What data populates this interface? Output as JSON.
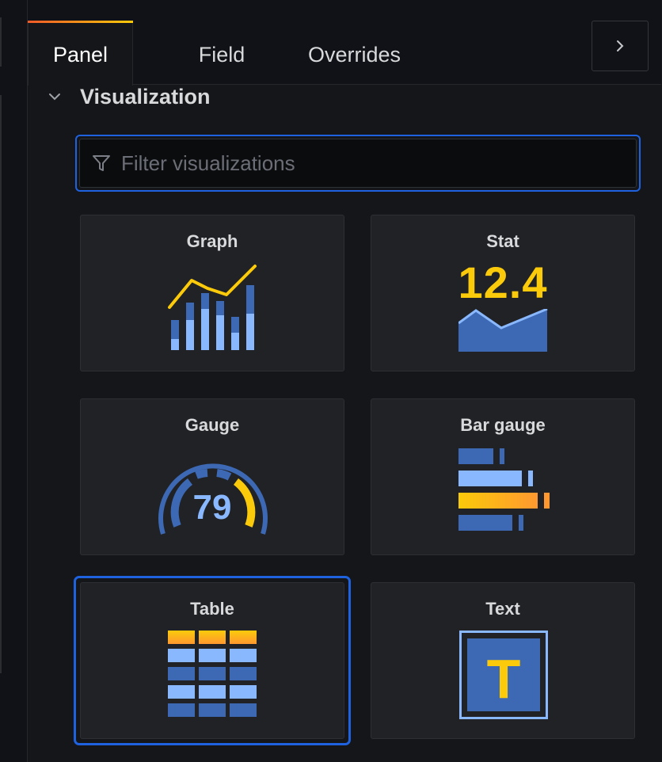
{
  "tabs": [
    {
      "label": "Panel",
      "active": true
    },
    {
      "label": "Field",
      "active": false
    },
    {
      "label": "Overrides",
      "active": false
    }
  ],
  "collapse_icon": "chevron-right-icon",
  "section": {
    "title": "Visualization",
    "icon": "chevron-down-icon",
    "expanded": true
  },
  "filter": {
    "placeholder": "Filter visualizations",
    "value": "",
    "icon": "filter-icon"
  },
  "visualizations": [
    {
      "name": "Graph",
      "icon": "graph-viz-icon",
      "selected": false
    },
    {
      "name": "Stat",
      "icon": "stat-viz-icon",
      "value_text": "12.4",
      "selected": false
    },
    {
      "name": "Gauge",
      "icon": "gauge-viz-icon",
      "value_text": "79",
      "selected": false
    },
    {
      "name": "Bar gauge",
      "icon": "bar-gauge-viz-icon",
      "selected": false
    },
    {
      "name": "Table",
      "icon": "table-viz-icon",
      "selected": true
    },
    {
      "name": "Text",
      "icon": "text-viz-icon",
      "glyph_text": "T",
      "selected": false
    }
  ],
  "colors": {
    "accent_blue": "#1f62e0",
    "viz_blue_dark": "#3d69b4",
    "viz_blue_light": "#8ab8ff",
    "viz_yellow": "#fbca0a",
    "viz_orange": "#ff9830"
  }
}
